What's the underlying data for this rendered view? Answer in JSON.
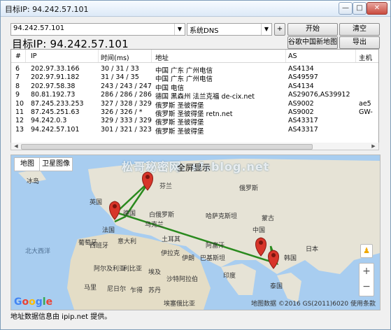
{
  "window": {
    "title": "目标IP: 94.242.57.101",
    "min": "—",
    "max": "□",
    "close": "✕"
  },
  "toolbar": {
    "ip_value": "94.242.57.101",
    "dns_value": "系统DNS",
    "plus_label": "+",
    "start_label": "开始",
    "clear_label": "清空",
    "google_map_label": "谷歌中国新地图",
    "export_label": "导出"
  },
  "target_line": "目标IP:  94.242.57.101",
  "table": {
    "headers": [
      "#",
      "IP",
      "时间(ms)",
      "地址",
      "AS",
      "主机"
    ],
    "rows": [
      {
        "n": "6",
        "ip": "202.97.33.166",
        "time": "30 / 31 / 33",
        "addr": "中国 广东 广州电信",
        "as": "AS4134",
        "host": ""
      },
      {
        "n": "7",
        "ip": "202.97.91.182",
        "time": "31 / 34 / 35",
        "addr": "中国 广东 广州电信",
        "as": "AS49597",
        "host": ""
      },
      {
        "n": "8",
        "ip": "202.97.58.38",
        "time": "243 / 243 / 247",
        "addr": "中国 电信",
        "as": "AS4134",
        "host": ""
      },
      {
        "n": "9",
        "ip": "80.81.192.73",
        "time": "286 / 286 / 286",
        "addr": "德国 黑森州 法兰克福 de-cix.net",
        "as": "AS29076,AS39912",
        "host": ""
      },
      {
        "n": "10",
        "ip": "87.245.233.253",
        "time": "327 / 328 / 329",
        "addr": "俄罗斯 圣彼得堡",
        "as": "AS9002",
        "host": "ae5"
      },
      {
        "n": "11",
        "ip": "87.245.251.63",
        "time": "326 / 326 / *",
        "addr": "俄罗斯 圣彼得堡 retn.net",
        "as": "AS9002",
        "host": "GW-"
      },
      {
        "n": "12",
        "ip": "94.242.0.3",
        "time": "329 / 333 / 329",
        "addr": "俄罗斯 圣彼得堡",
        "as": "AS43317",
        "host": ""
      },
      {
        "n": "13",
        "ip": "94.242.57.101",
        "time": "301 / 321 / 323",
        "addr": "俄罗斯 圣彼得堡",
        "as": "AS43317",
        "host": ""
      }
    ]
  },
  "map": {
    "tab_map": "地图",
    "tab_satellite": "卫星图像",
    "fullscreen": "全屏显示",
    "watermark": "松哥秘密网: sfsblog.net",
    "labels": {
      "iceland": "冰岛",
      "finland": "芬兰",
      "belarus": "白俄罗斯",
      "ukraine": "乌克兰",
      "russia": "俄罗斯",
      "kazakhstan": "哈萨克斯坦",
      "mongolia": "蒙古",
      "china": "中国",
      "turkey": "土耳其",
      "iran": "伊朗",
      "iraq": "伊拉克",
      "afghanistan": "阿富汗",
      "pakistan": "巴基斯坦",
      "india": "印度",
      "egypt": "埃及",
      "libya": "利比亚",
      "algeria": "阿尔及利亚",
      "mali": "马里",
      "niger": "尼日尔",
      "chad": "乍得",
      "sudan": "苏丹",
      "ethiopia": "埃塞俄比亚",
      "saudi": "沙特阿拉伯",
      "thailand": "泰国",
      "atlantic": "北大西洋",
      "uk": "英国",
      "france": "法国",
      "germany": "德国",
      "portugal": "葡萄牙",
      "spain": "西班牙",
      "italy": "意大利",
      "japan": "日本",
      "korea": "韩国"
    },
    "google": "Google",
    "credit": "地图数据 ©2016 GS(2011)6020   使用条款",
    "zoom_in": "+",
    "zoom_out": "−",
    "pegman": "♟"
  },
  "status": "地址数据信息由 ipip.net 提供。",
  "colors": {
    "route": "#2a8a1e",
    "pin": "#d8352a",
    "land": "#e6e3d6",
    "water": "#a8cdf0"
  }
}
